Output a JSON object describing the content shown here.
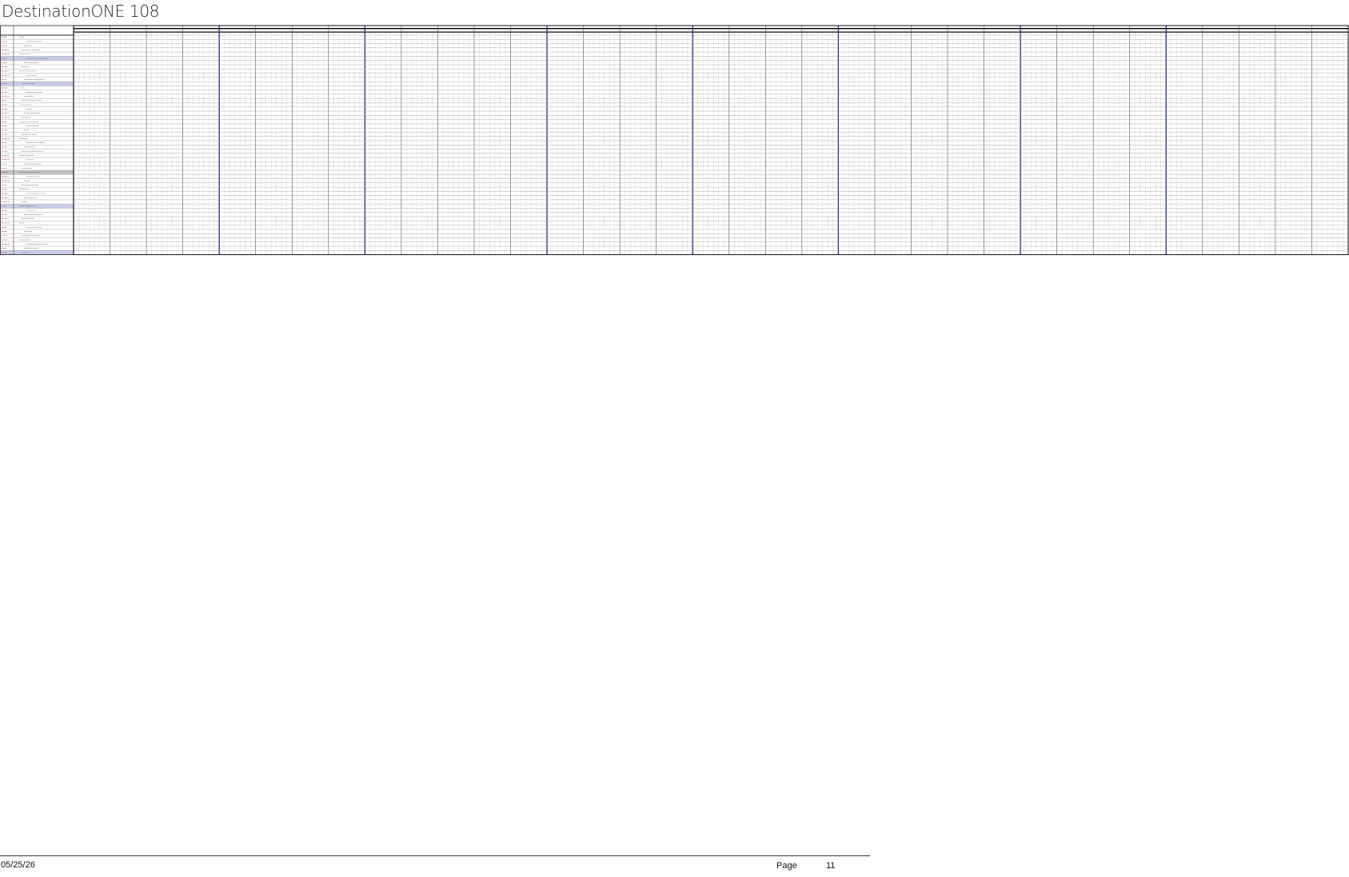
{
  "document": {
    "title": "DestinationONE 108"
  },
  "schedule": {
    "months_visible": 7,
    "weeks_visible": 35,
    "row_count": 52,
    "shaded_rows": [
      5,
      11,
      32,
      40,
      51
    ],
    "colors": {
      "grid_line": "#9a9a9a",
      "week_divider": "#555555",
      "month_divider": "#1f2f8a",
      "header_band": "#000000",
      "row_highlight": "#c9cde8",
      "row_gray": "#c4c4c4",
      "left_code_text": "#b03030",
      "left_desc_text": "#555555"
    }
  },
  "footer": {
    "date": "05/25/26",
    "page_label": "Page",
    "page_number": "11"
  }
}
